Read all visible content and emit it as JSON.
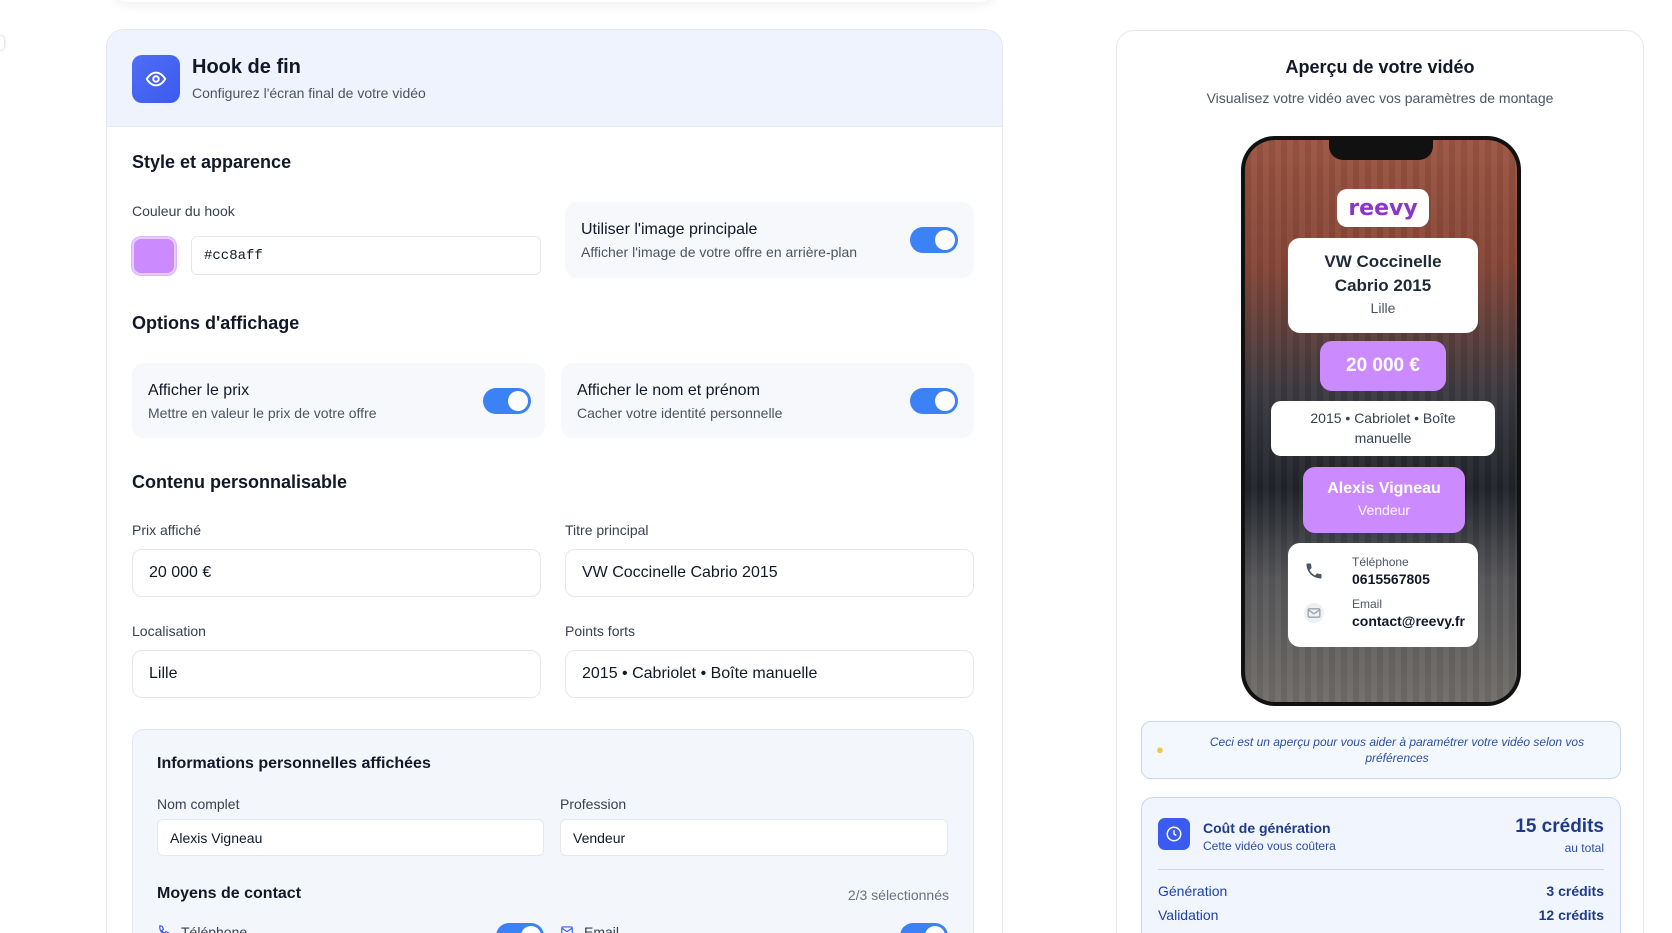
{
  "hook": {
    "title": "Hook de fin",
    "subtitle": "Configurez l'écran final de votre vidéo"
  },
  "style": {
    "section_title": "Style et apparence",
    "color_label": "Couleur du hook",
    "color_value": "#cc8aff",
    "use_image_title": "Utiliser l'image principale",
    "use_image_sub": "Afficher l'image de votre offre en arrière-plan",
    "use_image_on": true
  },
  "display": {
    "section_title": "Options d'affichage",
    "price_title": "Afficher le prix",
    "price_sub": "Mettre en valeur le prix de votre offre",
    "price_on": true,
    "name_title": "Afficher le nom et prénom",
    "name_sub": "Cacher votre identité personnelle",
    "name_on": true
  },
  "content": {
    "section_title": "Contenu personnalisable",
    "price_label": "Prix affiché",
    "price_value": "20 000 €",
    "title_label": "Titre principal",
    "title_value": "VW Coccinelle Cabrio 2015",
    "location_label": "Localisation",
    "location_value": "Lille",
    "highlights_label": "Points forts",
    "highlights_value": "2015 • Cabriolet • Boîte manuelle"
  },
  "personal": {
    "section_title": "Informations personnelles affichées",
    "name_label": "Nom complet",
    "name_value": "Alexis Vigneau",
    "job_label": "Profession",
    "job_value": "Vendeur",
    "contact_title": "Moyens de contact",
    "contact_count": "2/3 sélectionnés",
    "phone_label": "Téléphone",
    "email_label": "Email"
  },
  "preview": {
    "title": "Aperçu de votre vidéo",
    "subtitle": "Visualisez votre vidéo avec vos paramètres de montage",
    "logo_text": "reevy",
    "car_title": "VW Coccinelle Cabrio 2015",
    "car_location": "Lille",
    "price": "20 000 €",
    "features": "2015 • Cabriolet • Boîte manuelle",
    "person_name": "Alexis Vigneau",
    "person_job": "Vendeur",
    "phone_label": "Téléphone",
    "phone_value": "0615567805",
    "email_label": "Email",
    "email_value": "contact@reevy.fr",
    "tip": "Ceci est un aperçu pour vous aider à paramétrer votre vidéo selon vos préférences"
  },
  "cost": {
    "title": "Coût de génération",
    "subtitle": "Cette vidéo vous coûtera",
    "total": "15 crédits",
    "total_sub": "au total",
    "rows": [
      {
        "label": "Génération",
        "value": "3 crédits"
      },
      {
        "label": "Validation",
        "value": "12 crédits"
      }
    ]
  },
  "colors": {
    "accent": "#3b82f6",
    "hook": "#cc8aff",
    "header_bg": "#eef3fd"
  }
}
